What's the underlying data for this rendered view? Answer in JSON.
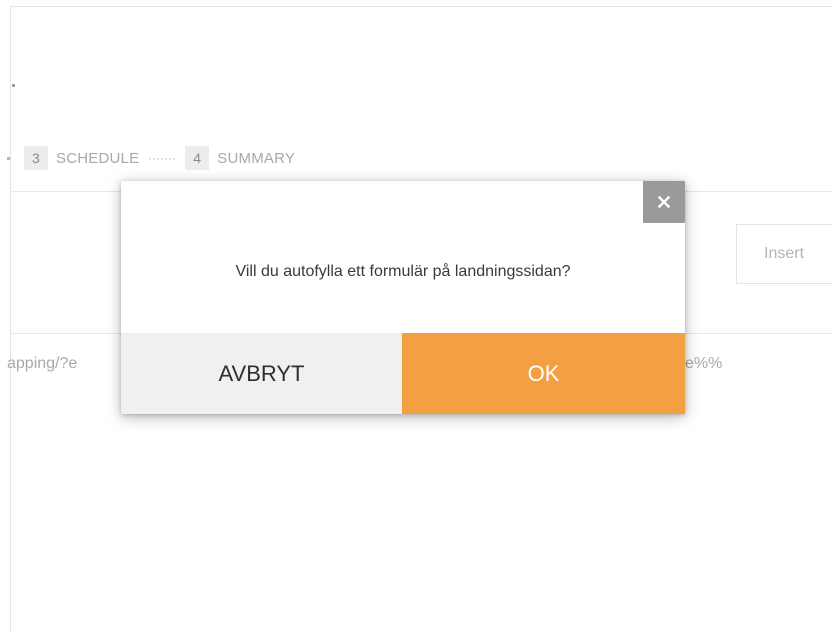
{
  "steps": [
    {
      "number": "3",
      "label": "SCHEDULE"
    },
    {
      "separator": "·······"
    },
    {
      "number": "4",
      "label": "SUMMARY"
    }
  ],
  "insert_button": {
    "label": "Insert"
  },
  "url_fragment_left": "apping/?e",
  "url_fragment_right": "e%%",
  "dialog": {
    "message": "Vill du autofylla ett formulär på landningssidan?",
    "cancel_label": "AVBRYT",
    "ok_label": "OK",
    "close_icon": "close-icon"
  },
  "colors": {
    "ok_button": "#f4a042",
    "cancel_button": "#f0f0f0",
    "close_button": "#9a9a9a"
  }
}
